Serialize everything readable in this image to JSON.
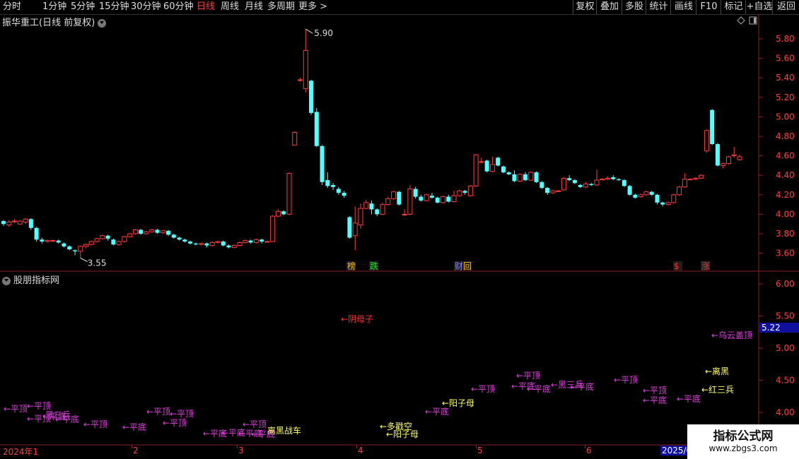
{
  "toolbar": {
    "left": [
      "分时",
      "1分钟",
      "5分钟",
      "15分钟",
      "30分钟",
      "60分钟",
      "日线",
      "周线",
      "月线",
      "多周期",
      "更多 >"
    ],
    "active": "日线",
    "right": [
      "复权",
      "叠加",
      "多股",
      "统计",
      "画线",
      "F10",
      "标记",
      "+自选",
      "返回"
    ]
  },
  "main_title": "振华重工(日线 前复权)",
  "sub_title": "股朋指标网",
  "price_axis": [
    "5.80",
    "5.60",
    "5.40",
    "5.20",
    "5.00",
    "4.80",
    "4.60",
    "4.40",
    "4.20",
    "4.00",
    "3.80",
    "3.60"
  ],
  "indicator_axis": [
    "6.00",
    "5.50",
    "5.00",
    "4.50",
    "4.00"
  ],
  "indicator_value": "5.22",
  "high_label": "5.90",
  "low_label": "3.55",
  "event_badges": [
    {
      "text": "榜",
      "color": "#ffb000"
    },
    {
      "text": "跌",
      "color": "#20e020"
    },
    {
      "text": "财",
      "color": "#8080ff"
    },
    {
      "text": "回",
      "color": "#ffb000"
    },
    {
      "text": "$",
      "color": "#ff3030"
    },
    {
      "text": "涨",
      "color": "#ff3030"
    }
  ],
  "pattern_labels": [
    {
      "text": "←平顶",
      "color": "#e040e0"
    },
    {
      "text": "←平顶",
      "color": "#e040e0"
    },
    {
      "text": "←平顶",
      "color": "#e040e0"
    },
    {
      "text": "←平底",
      "color": "#e040e0"
    },
    {
      "text": "←平底",
      "color": "#e040e0"
    },
    {
      "text": "黑三兵",
      "color": "#e040e0"
    },
    {
      "text": "←平顶",
      "color": "#e040e0"
    },
    {
      "text": "←平顶",
      "color": "#e040e0"
    },
    {
      "text": "←平底",
      "color": "#e040e0"
    },
    {
      "text": "←平顶",
      "color": "#e040e0"
    },
    {
      "text": "←平顶",
      "color": "#e040e0"
    },
    {
      "text": "←平底",
      "color": "#e040e0"
    },
    {
      "text": "←平底",
      "color": "#e040e0"
    },
    {
      "text": "←平底",
      "color": "#e040e0"
    },
    {
      "text": "←平顶",
      "color": "#e040e0"
    },
    {
      "text": "←平底",
      "color": "#e040e0"
    },
    {
      "text": "离黑战车",
      "color": "#ffff60"
    },
    {
      "text": "←阴母子",
      "color": "#ff3030"
    },
    {
      "text": "←多戳空",
      "color": "#ffff60"
    },
    {
      "text": "←阳子母",
      "color": "#ffff60"
    },
    {
      "text": "←平底",
      "color": "#e040e0"
    },
    {
      "text": "←阳子母",
      "color": "#ffff60"
    },
    {
      "text": "←平顶",
      "color": "#e040e0"
    },
    {
      "text": "←平顶",
      "color": "#e040e0"
    },
    {
      "text": "←平底",
      "color": "#e040e0"
    },
    {
      "text": "←平底",
      "color": "#e040e0"
    },
    {
      "text": "←黑三兵",
      "color": "#e040e0"
    },
    {
      "text": "←平底",
      "color": "#e040e0"
    },
    {
      "text": "←平顶",
      "color": "#e040e0"
    },
    {
      "text": "←平顶",
      "color": "#e040e0"
    },
    {
      "text": "←平底",
      "color": "#e040e0"
    },
    {
      "text": "←乌云盖顶",
      "color": "#e040e0"
    },
    {
      "text": "←离黑",
      "color": "#ffff60"
    },
    {
      "text": "←平底",
      "color": "#e040e0"
    },
    {
      "text": "←红三兵",
      "color": "#ffff60"
    }
  ],
  "date_axis": [
    "2024年1",
    "2",
    "3",
    "4",
    "5",
    "6",
    "2025/0"
  ],
  "watermark": {
    "title": "指标公式网",
    "url": "www.zbgs3.com"
  },
  "chart_data": {
    "type": "candlestick",
    "title": "振华重工(日线 前复权)",
    "ylim": [
      3.5,
      5.9
    ],
    "colors": {
      "up": "#ff3c3c",
      "down": "#54ffff"
    },
    "candles": [
      [
        3.93,
        3.9,
        3.94,
        3.88
      ],
      [
        3.89,
        3.92,
        3.94,
        3.87
      ],
      [
        3.93,
        3.93,
        3.95,
        3.91
      ],
      [
        3.9,
        3.93,
        3.94,
        3.89
      ],
      [
        3.92,
        3.95,
        3.96,
        3.9
      ],
      [
        3.95,
        3.86,
        3.96,
        3.84
      ],
      [
        3.86,
        3.74,
        3.87,
        3.72
      ],
      [
        3.74,
        3.72,
        3.76,
        3.7
      ],
      [
        3.72,
        3.73,
        3.74,
        3.71
      ],
      [
        3.73,
        3.73,
        3.74,
        3.72
      ],
      [
        3.73,
        3.71,
        3.74,
        3.7
      ],
      [
        3.7,
        3.67,
        3.71,
        3.66
      ],
      [
        3.67,
        3.64,
        3.68,
        3.63
      ],
      [
        3.63,
        3.62,
        3.64,
        3.58
      ],
      [
        3.62,
        3.67,
        3.68,
        3.55
      ],
      [
        3.67,
        3.69,
        3.7,
        3.65
      ],
      [
        3.69,
        3.72,
        3.73,
        3.68
      ],
      [
        3.72,
        3.75,
        3.76,
        3.71
      ],
      [
        3.75,
        3.78,
        3.79,
        3.74
      ],
      [
        3.78,
        3.75,
        3.79,
        3.73
      ],
      [
        3.74,
        3.69,
        3.75,
        3.68
      ],
      [
        3.69,
        3.72,
        3.73,
        3.68
      ],
      [
        3.72,
        3.77,
        3.78,
        3.71
      ],
      [
        3.77,
        3.8,
        3.81,
        3.76
      ],
      [
        3.8,
        3.84,
        3.85,
        3.79
      ],
      [
        3.84,
        3.8,
        3.85,
        3.79
      ],
      [
        3.8,
        3.82,
        3.83,
        3.79
      ],
      [
        3.82,
        3.84,
        3.85,
        3.81
      ],
      [
        3.84,
        3.81,
        3.85,
        3.8
      ],
      [
        3.81,
        3.83,
        3.84,
        3.8
      ],
      [
        3.83,
        3.79,
        3.84,
        3.78
      ],
      [
        3.79,
        3.76,
        3.8,
        3.75
      ],
      [
        3.76,
        3.74,
        3.77,
        3.73
      ],
      [
        3.74,
        3.72,
        3.75,
        3.71
      ],
      [
        3.72,
        3.7,
        3.73,
        3.69
      ],
      [
        3.7,
        3.69,
        3.71,
        3.68
      ],
      [
        3.69,
        3.7,
        3.71,
        3.68
      ],
      [
        3.7,
        3.68,
        3.71,
        3.66
      ],
      [
        3.68,
        3.71,
        3.72,
        3.67
      ],
      [
        3.71,
        3.72,
        3.73,
        3.7
      ],
      [
        3.72,
        3.68,
        3.73,
        3.67
      ],
      [
        3.68,
        3.66,
        3.69,
        3.65
      ],
      [
        3.66,
        3.68,
        3.69,
        3.65
      ],
      [
        3.68,
        3.71,
        3.72,
        3.67
      ],
      [
        3.71,
        3.73,
        3.74,
        3.7
      ],
      [
        3.73,
        3.71,
        3.74,
        3.7
      ],
      [
        3.71,
        3.74,
        3.75,
        3.7
      ],
      [
        3.74,
        3.72,
        3.75,
        3.7
      ],
      [
        3.72,
        3.72,
        3.73,
        3.71
      ],
      [
        3.72,
        3.98,
        3.99,
        3.72
      ],
      [
        3.98,
        4.03,
        4.05,
        3.97
      ],
      [
        4.03,
        4.0,
        4.04,
        3.99
      ],
      [
        4.0,
        4.42,
        4.43,
        3.99
      ],
      [
        4.71,
        4.84,
        4.85,
        4.74
      ],
      [
        5.38,
        5.38,
        5.4,
        5.36
      ],
      [
        5.29,
        5.68,
        5.9,
        5.25
      ],
      [
        5.37,
        5.04,
        5.38,
        5.02
      ],
      [
        5.05,
        4.7,
        5.09,
        4.69
      ],
      [
        4.7,
        4.33,
        4.71,
        4.3
      ],
      [
        4.35,
        4.29,
        4.43,
        4.27
      ],
      [
        4.3,
        4.28,
        4.32,
        4.25
      ],
      [
        4.26,
        4.22,
        4.28,
        4.2
      ],
      [
        4.22,
        4.19,
        4.24,
        4.17
      ],
      [
        3.97,
        3.76,
        3.98,
        3.75
      ],
      [
        3.78,
        3.91,
        4.08,
        3.63
      ],
      [
        3.89,
        4.06,
        4.11,
        3.85
      ],
      [
        4.06,
        4.12,
        4.15,
        4.05
      ],
      [
        4.11,
        4.05,
        4.14,
        4.0
      ],
      [
        4.05,
        4.0,
        4.06,
        3.98
      ],
      [
        4.0,
        4.1,
        4.12,
        3.99
      ],
      [
        4.1,
        4.16,
        4.18,
        4.09
      ],
      [
        4.16,
        4.23,
        4.24,
        4.15
      ],
      [
        4.23,
        4.1,
        4.24,
        4.09
      ],
      [
        4.0,
        4.0,
        4.05,
        3.98
      ],
      [
        4.0,
        4.26,
        4.3,
        3.99
      ],
      [
        4.26,
        4.18,
        4.28,
        4.16
      ],
      [
        4.18,
        4.14,
        4.2,
        4.13
      ],
      [
        4.14,
        4.2,
        4.21,
        4.13
      ],
      [
        4.19,
        4.17,
        4.22,
        4.16
      ],
      [
        4.17,
        4.12,
        4.18,
        4.11
      ],
      [
        4.12,
        4.18,
        4.19,
        4.11
      ],
      [
        4.18,
        4.13,
        4.2,
        4.12
      ],
      [
        4.13,
        4.19,
        4.24,
        4.12
      ],
      [
        4.19,
        4.24,
        4.25,
        4.18
      ],
      [
        4.24,
        4.22,
        4.25,
        4.2
      ],
      [
        4.19,
        4.29,
        4.3,
        4.18
      ],
      [
        4.29,
        4.61,
        4.62,
        4.28
      ],
      [
        4.54,
        4.54,
        4.58,
        4.52
      ],
      [
        4.55,
        4.44,
        4.56,
        4.43
      ],
      [
        4.44,
        4.51,
        4.59,
        4.43
      ],
      [
        4.58,
        4.5,
        4.59,
        4.49
      ],
      [
        4.49,
        4.43,
        4.5,
        4.42
      ],
      [
        4.43,
        4.41,
        4.44,
        4.4
      ],
      [
        4.41,
        4.34,
        4.45,
        4.33
      ],
      [
        4.34,
        4.41,
        4.42,
        4.33
      ],
      [
        4.41,
        4.35,
        4.43,
        4.34
      ],
      [
        4.35,
        4.43,
        4.44,
        4.34
      ],
      [
        4.43,
        4.33,
        4.44,
        4.32
      ],
      [
        4.33,
        4.27,
        4.34,
        4.26
      ],
      [
        4.27,
        4.22,
        4.28,
        4.2
      ],
      [
        4.22,
        4.24,
        4.25,
        4.21
      ],
      [
        4.24,
        4.24,
        4.25,
        4.23
      ],
      [
        4.25,
        4.37,
        4.38,
        4.24
      ],
      [
        4.37,
        4.35,
        4.4,
        4.34
      ],
      [
        4.35,
        4.32,
        4.36,
        4.31
      ],
      [
        4.3,
        4.28,
        4.31,
        4.27
      ],
      [
        4.28,
        4.31,
        4.33,
        4.27
      ],
      [
        4.31,
        4.3,
        4.32,
        4.29
      ],
      [
        4.3,
        4.35,
        4.46,
        4.29
      ],
      [
        4.36,
        4.36,
        4.37,
        4.35
      ],
      [
        4.36,
        4.37,
        4.39,
        4.35
      ],
      [
        4.38,
        4.36,
        4.4,
        4.35
      ],
      [
        4.36,
        4.35,
        4.37,
        4.34
      ],
      [
        4.35,
        4.29,
        4.36,
        4.28
      ],
      [
        4.29,
        4.2,
        4.3,
        4.19
      ],
      [
        4.2,
        4.17,
        4.21,
        4.16
      ],
      [
        4.18,
        4.2,
        4.21,
        4.17
      ],
      [
        4.2,
        4.23,
        4.24,
        4.19
      ],
      [
        4.23,
        4.2,
        4.24,
        4.19
      ],
      [
        4.2,
        4.12,
        4.21,
        4.1
      ],
      [
        4.12,
        4.1,
        4.13,
        4.08
      ],
      [
        4.1,
        4.12,
        4.13,
        4.09
      ],
      [
        4.12,
        4.2,
        4.21,
        4.11
      ],
      [
        4.2,
        4.28,
        4.29,
        4.19
      ],
      [
        4.28,
        4.36,
        4.42,
        4.27
      ],
      [
        4.36,
        4.36,
        4.37,
        4.35
      ],
      [
        4.36,
        4.37,
        4.38,
        4.35
      ],
      [
        4.37,
        4.4,
        4.41,
        4.36
      ],
      [
        4.65,
        4.86,
        4.87,
        4.63
      ],
      [
        5.07,
        4.72,
        5.08,
        4.71
      ],
      [
        4.72,
        4.5,
        4.73,
        4.49
      ],
      [
        4.5,
        4.52,
        4.53,
        4.47
      ],
      [
        4.52,
        4.59,
        4.6,
        4.51
      ],
      [
        4.6,
        4.61,
        4.69,
        4.58
      ],
      [
        4.56,
        4.59,
        4.61,
        4.55
      ]
    ],
    "indicator_ylim": [
      3.6,
      6.2
    ]
  }
}
